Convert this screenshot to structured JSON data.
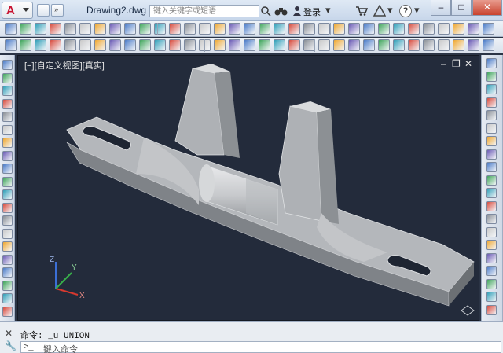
{
  "titlebar": {
    "app_logo": "A",
    "doc_title": "Drawing2.dwg",
    "search_placeholder": "键入关键字或短语",
    "login_label": "登录",
    "help_label": "?",
    "controls": {
      "minimize": "–",
      "maximize": "□",
      "close": "✕"
    }
  },
  "viewport": {
    "label": "[−][自定义视图][真实]",
    "controls": {
      "minimize": "–",
      "restore": "❐",
      "close": "✕"
    },
    "background_color": "#232b3b",
    "ucs": {
      "x_axis": "X",
      "y_axis": "Y",
      "z_axis": "Z"
    }
  },
  "command": {
    "history_line": "命令: _u UNION",
    "prompt_placeholder": "键入命令",
    "prompt_chevron": ">_"
  },
  "colors": {
    "accent": "#c8102e",
    "toolbar_bg": "#e3e9f1",
    "viewport_bg": "#232b3b",
    "part_face": "#b9bcc0"
  }
}
